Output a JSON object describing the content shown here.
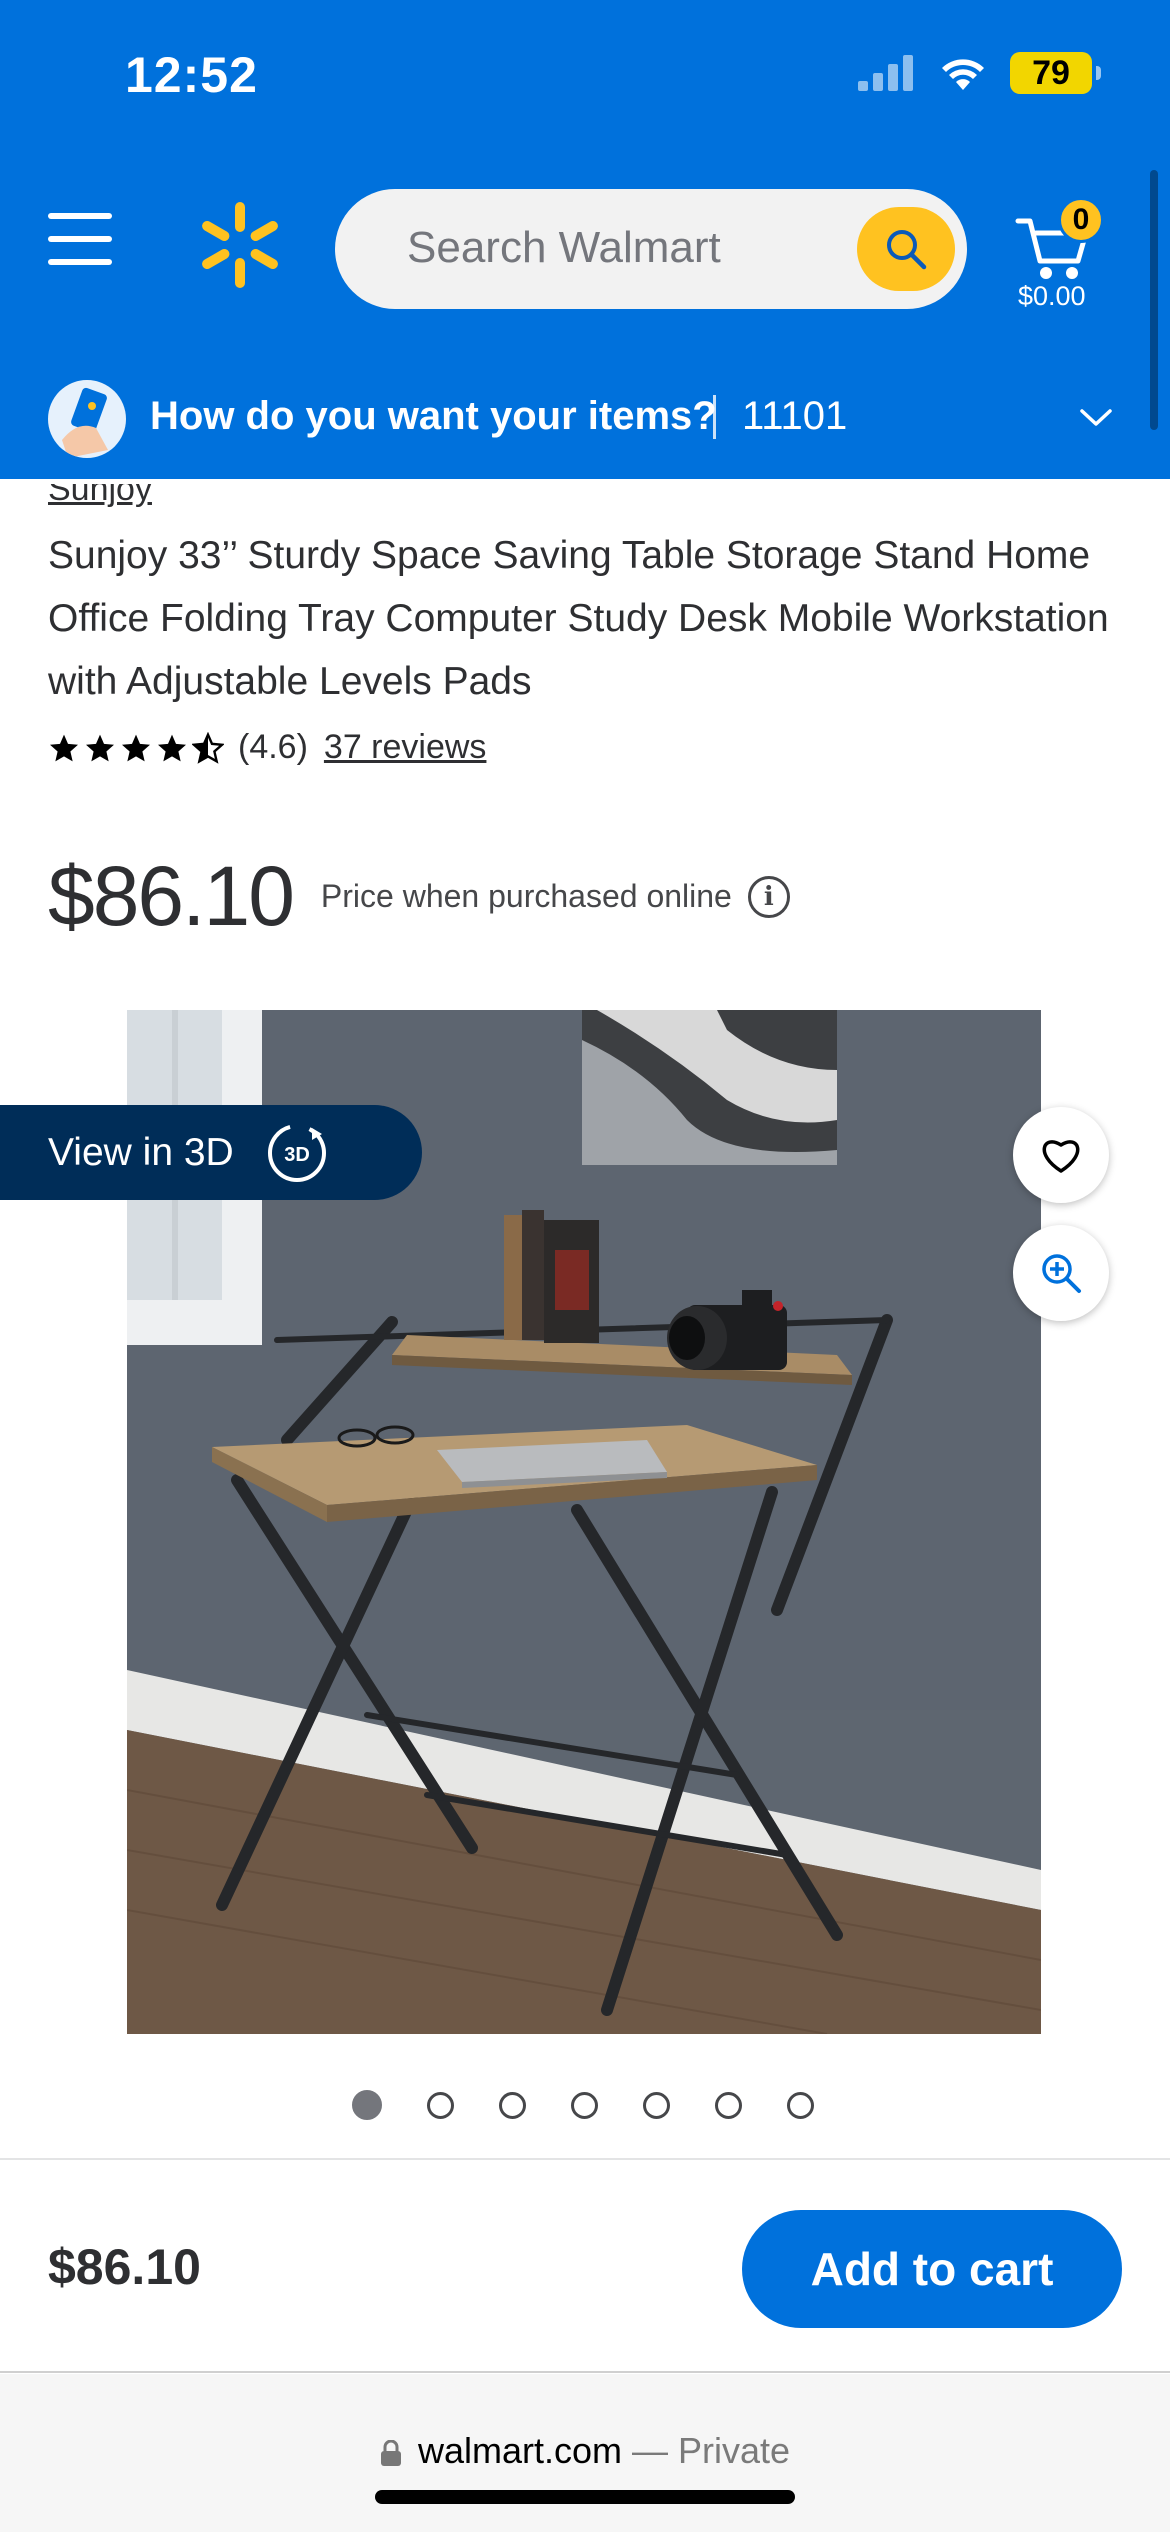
{
  "status_bar": {
    "time": "12:52",
    "battery": "79"
  },
  "header": {
    "search_placeholder": "Search Walmart",
    "cart_count": "0",
    "cart_total": "$0.00",
    "fulfillment_prompt": "How do you want your items?",
    "zip": "11101"
  },
  "product": {
    "brand": "Sunjoy",
    "title": "Sunjoy 33’’ Sturdy Space Saving Table Storage Stand Home Office Folding Tray Computer Study Desk Mobile Workstation with Adjustable Levels Pads",
    "rating_value": "(4.6)",
    "rating_fraction": 0.92,
    "reviews": "37 reviews",
    "price": "$86.10",
    "price_note": "Price when purchased online",
    "view_3d_label": "View in 3D",
    "image_count": 7,
    "active_image_index": 0
  },
  "sticky": {
    "price": "$86.10",
    "add_to_cart": "Add to cart"
  },
  "browser": {
    "domain": "walmart.com",
    "mode": " — Private"
  },
  "icons": [
    "menu-icon",
    "spark-logo-icon",
    "search-icon",
    "cart-icon",
    "chevron-down-icon",
    "star-icon",
    "info-icon",
    "3d-view-icon",
    "heart-icon",
    "zoom-icon",
    "lock-icon"
  ],
  "colors": {
    "brand_blue": "#0071dc",
    "brand_yellow": "#ffc220",
    "dark_blue": "#002d58"
  }
}
